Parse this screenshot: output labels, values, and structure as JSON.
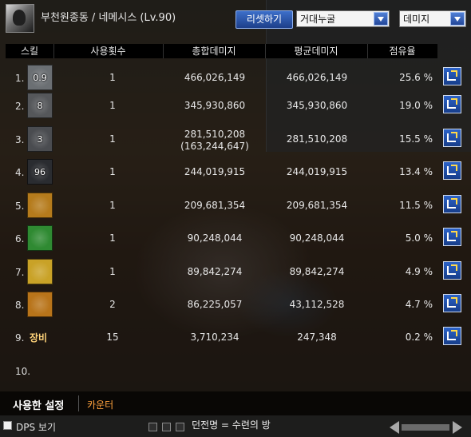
{
  "header": {
    "character": "부천원종동 / 네메시스 (Lv.90)",
    "reset_button": "리셋하기",
    "dungeon_select": "거대누굴",
    "metric_select": "데미지"
  },
  "columns": [
    "스킬",
    "사용횟수",
    "총합데미지",
    "평균데미지",
    "점유율"
  ],
  "rows": [
    {
      "num": "1.",
      "level": "0.9",
      "uses": "1",
      "total": "466,026,149",
      "avg": "466,026,149",
      "share": "25.6 %",
      "icon": "gear-skill-icon",
      "color": "#6b6f73"
    },
    {
      "num": "2.",
      "level": "8",
      "uses": "1",
      "total": "345,930,860",
      "avg": "345,930,860",
      "share": "19.0 %",
      "icon": "spiked-skill-icon",
      "color": "#55575a"
    },
    {
      "num": "3.",
      "level": "3",
      "uses": "1",
      "total": "281,510,208",
      "total_sub": "(163,244,647)",
      "avg": "281,510,208",
      "share": "15.5 %",
      "icon": "shadow-skill-icon",
      "color": "#4a4c50"
    },
    {
      "num": "4.",
      "level": "96",
      "uses": "1",
      "total": "244,019,915",
      "avg": "244,019,915",
      "share": "13.4 %",
      "icon": "cross-skill-icon",
      "color": "#2a2c30"
    },
    {
      "num": "5.",
      "level": "",
      "uses": "1",
      "total": "209,681,354",
      "avg": "209,681,354",
      "share": "11.5 %",
      "icon": "flame-skill-icon",
      "color": "#b57b1c"
    },
    {
      "num": "6.",
      "level": "",
      "uses": "1",
      "total": "90,248,044",
      "avg": "90,248,044",
      "share": "5.0 %",
      "icon": "thorn-skill-icon",
      "color": "#2f8a32"
    },
    {
      "num": "7.",
      "level": "",
      "uses": "1",
      "total": "89,842,274",
      "avg": "89,842,274",
      "share": "4.9 %",
      "icon": "burst-skill-icon",
      "color": "#c9a227"
    },
    {
      "num": "8.",
      "level": "",
      "uses": "2",
      "total": "86,225,057",
      "avg": "43,112,528",
      "share": "4.7 %",
      "icon": "vortex-skill-icon",
      "color": "#b8741a"
    },
    {
      "num": "9.",
      "equip": "장비",
      "uses": "15",
      "total": "3,710,234",
      "avg": "247,348",
      "share": "0.2 %"
    },
    {
      "num": "10."
    }
  ],
  "tabs": {
    "used": "사용한 설정",
    "counter": "카운터"
  },
  "footer": {
    "dps": "DPS 보기",
    "dungeon": "던전명 = 수련의 방"
  }
}
